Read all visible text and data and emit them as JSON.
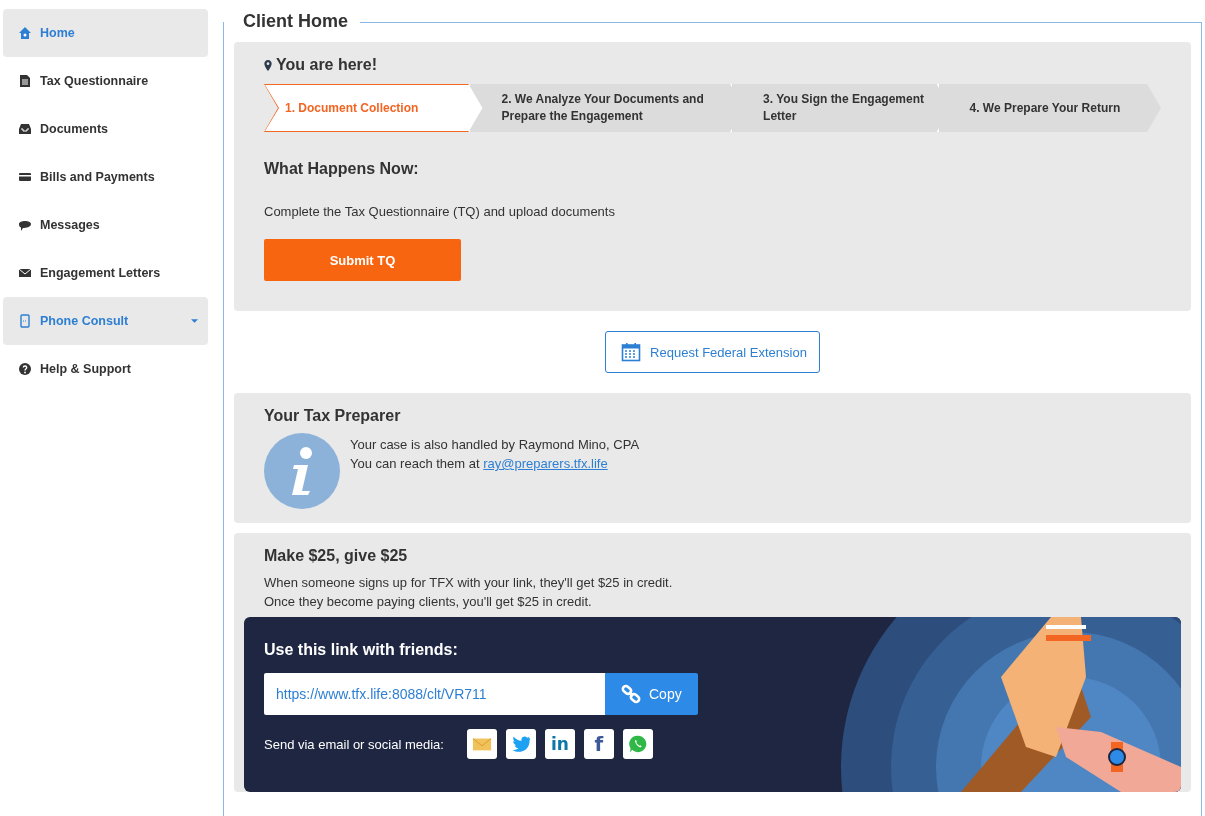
{
  "sidebar": {
    "items": [
      {
        "label": "Home",
        "kind": "home",
        "selected": true,
        "has_dropdown": false
      },
      {
        "label": "Tax Questionnaire",
        "kind": "document",
        "selected": false,
        "has_dropdown": false
      },
      {
        "label": "Documents",
        "kind": "inbox",
        "selected": false,
        "has_dropdown": false
      },
      {
        "label": "Bills and Payments",
        "kind": "card",
        "selected": false,
        "has_dropdown": false
      },
      {
        "label": "Messages",
        "kind": "chat",
        "selected": false,
        "has_dropdown": false
      },
      {
        "label": "Engagement Letters",
        "kind": "envelope",
        "selected": false,
        "has_dropdown": false
      },
      {
        "label": "Phone Consult",
        "kind": "phone",
        "selected": true,
        "has_dropdown": true
      },
      {
        "label": "Help & Support",
        "kind": "help",
        "selected": false,
        "has_dropdown": false
      }
    ]
  },
  "page_title": "Client Home",
  "progress": {
    "title": "You are here!",
    "steps": [
      {
        "label": "1. Document Collection",
        "selected": true
      },
      {
        "label": "2. We Analyze Your Documents and Prepare the Engagement",
        "selected": false
      },
      {
        "label": "3. You Sign the Engagement Letter",
        "selected": false
      },
      {
        "label": "4. We Prepare Your Return",
        "selected": false
      }
    ],
    "subtitle": "What Happens Now:",
    "description": "Complete the Tax Questionnaire (TQ) and upload documents",
    "button": "Submit TQ"
  },
  "extension_button": "Request Federal Extension",
  "preparer": {
    "title": "Your Tax Preparer",
    "line_1": "Your case is also handled by Raymond Mino, CPA",
    "line_2": "You can reach them at",
    "email": "ray@preparers.tfx.life"
  },
  "referral": {
    "title": "Make $25, give $25",
    "line_1": "When someone signs up for TFX with your link, they'll get $25 in credit.",
    "line_2": "Once they become paying clients, you'll get $25 in credit.",
    "link_title": "Use this link with friends:",
    "link": "https://www.tfx.life:8088/clt/VR711",
    "copy_button": "Copy",
    "share_label": "Send via email or social media:",
    "share_buttons": [
      {
        "kind": "email"
      },
      {
        "kind": "twitter"
      },
      {
        "kind": "linkedin",
        "glyph": "in"
      },
      {
        "kind": "facebook",
        "glyph": "f"
      },
      {
        "kind": "whatsapp"
      }
    ]
  }
}
